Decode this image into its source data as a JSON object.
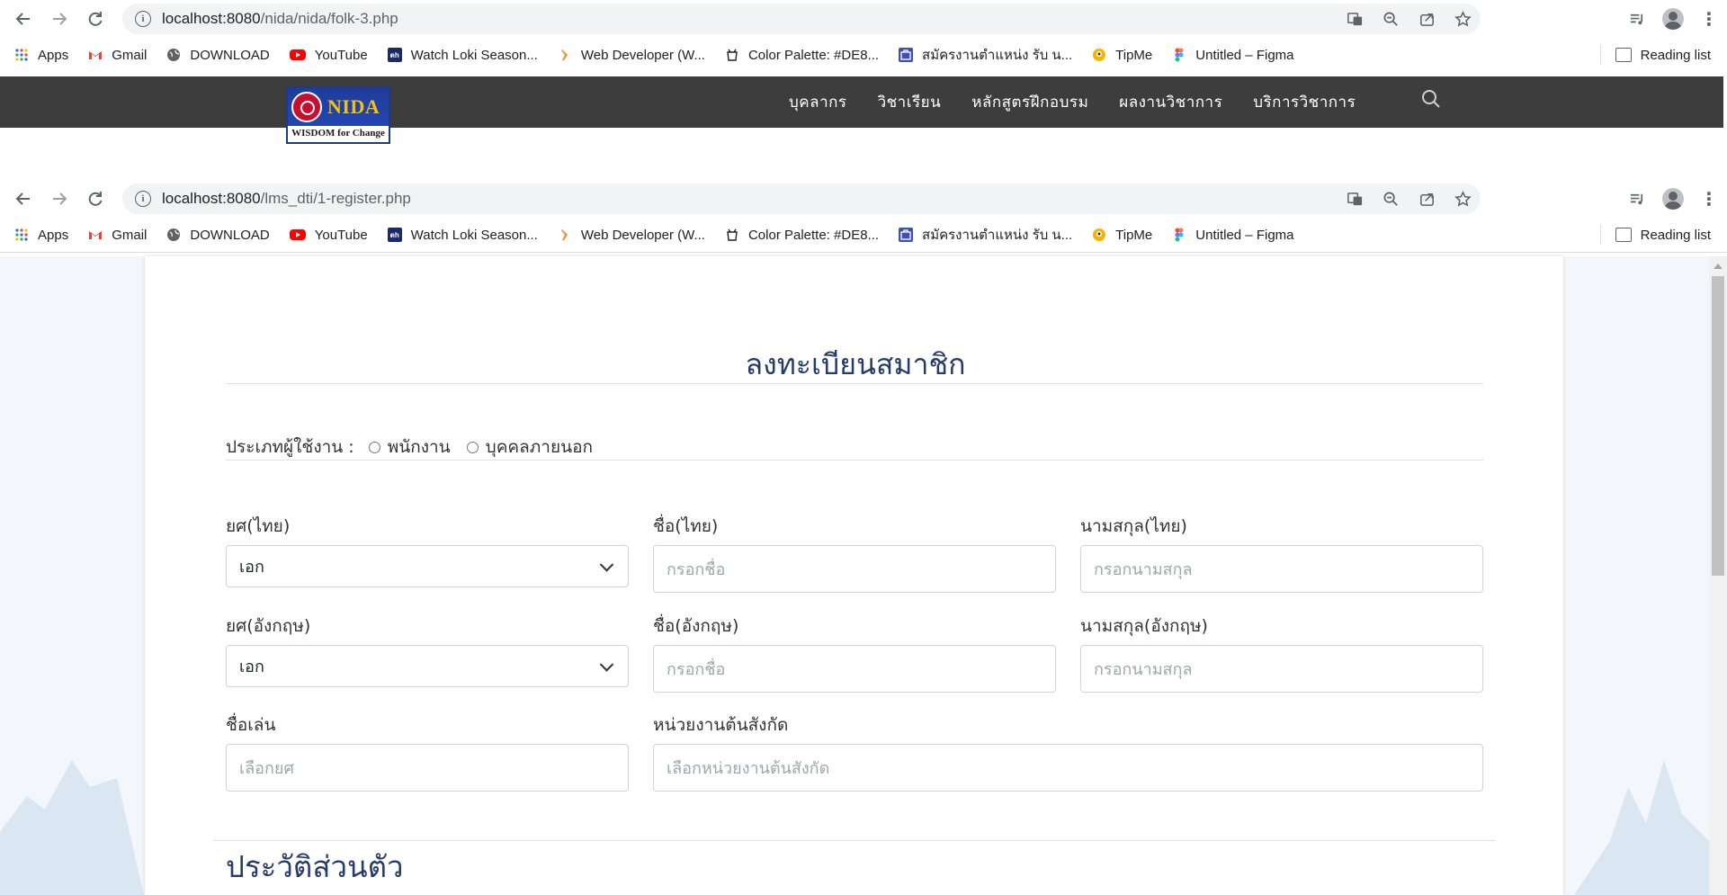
{
  "browser1": {
    "url_host": "localhost:8080",
    "url_path": "/nida/nida/folk-3.php"
  },
  "browser2": {
    "url_host": "localhost:8080",
    "url_path": "/lms_dti/1-register.php"
  },
  "bookmarks": [
    {
      "label": "Apps",
      "icon": "apps-grid-icon"
    },
    {
      "label": "Gmail",
      "icon": "gmail-icon"
    },
    {
      "label": "DOWNLOAD",
      "icon": "globe-icon"
    },
    {
      "label": "YouTube",
      "icon": "youtube-icon"
    },
    {
      "label": "Watch Loki Season...",
      "icon": "site-favicon"
    },
    {
      "label": "Web Developer (W...",
      "icon": "site-favicon"
    },
    {
      "label": "Color Palette: #DE8...",
      "icon": "palette-icon"
    },
    {
      "label": "สมัครงานตำแหน่ง รับ น...",
      "icon": "job-site-icon"
    },
    {
      "label": "TipMe",
      "icon": "tipme-icon"
    },
    {
      "label": "Untitled – Figma",
      "icon": "figma-icon"
    }
  ],
  "reading_list": "Reading list",
  "site": {
    "logo_name": "NIDA",
    "logo_tagline": "WISDOM for Change",
    "menu": [
      "บุคลากร",
      "วิชาเรียน",
      "หลักสูตรฝึกอบรม",
      "ผลงานวิชาการ",
      "บริการวิชาการ"
    ]
  },
  "form": {
    "title": "ลงทะเบียนสมาชิก",
    "user_type_label": "ประเภทผู้ใช้งาน :",
    "user_type_options": [
      "พนักงาน",
      "บุคคลภายนอก"
    ],
    "rank_th_label": "ยศ(ไทย)",
    "rank_th_value": "เอก",
    "first_th_label": "ชื่อ(ไทย)",
    "first_th_placeholder": "กรอกชื่อ",
    "last_th_label": "นามสกุล(ไทย)",
    "last_th_placeholder": "กรอกนามสกุล",
    "rank_en_label": "ยศ(อังกฤษ)",
    "rank_en_value": "เอก",
    "first_en_label": "ชื่อ(อังกฤษ)",
    "first_en_placeholder": "กรอกชื่อ",
    "last_en_label": "นามสกุล(อังกฤษ)",
    "last_en_placeholder": "กรอกนามสกุล",
    "nickname_label": "ชื่อเล่น",
    "nickname_placeholder": "เลือกยศ",
    "unit_label": "หน่วยงานต้นสังกัด",
    "unit_placeholder": "เลือกหน่วยงานต้นสังกัด",
    "section_personal": "ประวัติส่วนตัว"
  },
  "colors": {
    "header_bg": "#3d3d3d",
    "title_color": "#243b6b"
  }
}
